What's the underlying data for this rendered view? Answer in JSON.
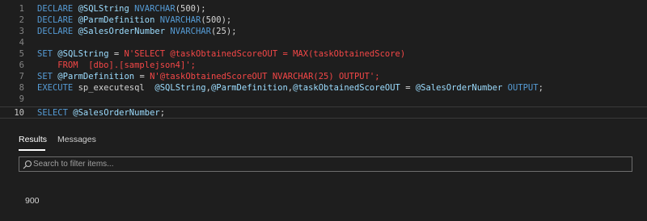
{
  "editor": {
    "lines": [
      {
        "n": "1",
        "tokens": [
          [
            "kw",
            "DECLARE "
          ],
          [
            "var",
            "@SQLString "
          ],
          [
            "kw",
            "NVARCHAR"
          ],
          [
            "plain",
            "(500);"
          ]
        ]
      },
      {
        "n": "2",
        "tokens": [
          [
            "kw",
            "DECLARE "
          ],
          [
            "var",
            "@ParmDefinition "
          ],
          [
            "kw",
            "NVARCHAR"
          ],
          [
            "plain",
            "(500);"
          ]
        ]
      },
      {
        "n": "3",
        "tokens": [
          [
            "kw",
            "DECLARE "
          ],
          [
            "var",
            "@SalesOrderNumber "
          ],
          [
            "kw",
            "NVARCHAR"
          ],
          [
            "plain",
            "(25);"
          ]
        ]
      },
      {
        "n": "4",
        "tokens": []
      },
      {
        "n": "5",
        "tokens": [
          [
            "kw",
            "SET "
          ],
          [
            "var",
            "@SQLString "
          ],
          [
            "plain",
            "= "
          ],
          [
            "str",
            "N'SELECT @taskObtainedScoreOUT = MAX(taskObtainedScore)"
          ]
        ]
      },
      {
        "n": "6",
        "tokens": [
          [
            "str",
            "    FROM  [dbo].[samplejson4]';"
          ]
        ]
      },
      {
        "n": "7",
        "tokens": [
          [
            "kw",
            "SET "
          ],
          [
            "var",
            "@ParmDefinition "
          ],
          [
            "plain",
            "= "
          ],
          [
            "str",
            "N'@taskObtainedScoreOUT NVARCHAR(25) OUTPUT';"
          ]
        ]
      },
      {
        "n": "8",
        "tokens": [
          [
            "kw",
            "EXECUTE "
          ],
          [
            "plain",
            "sp_executesql  "
          ],
          [
            "var",
            "@SQLString"
          ],
          [
            "plain",
            ","
          ],
          [
            "var",
            "@ParmDefinition"
          ],
          [
            "plain",
            ","
          ],
          [
            "var",
            "@taskObtainedScoreOUT "
          ],
          [
            "plain",
            "= "
          ],
          [
            "var",
            "@SalesOrderNumber "
          ],
          [
            "kw",
            "OUTPUT"
          ],
          [
            "plain",
            ";"
          ]
        ]
      },
      {
        "n": "9",
        "tokens": []
      },
      {
        "n": "10",
        "tokens": [
          [
            "kw",
            "SELECT "
          ],
          [
            "var",
            "@SalesOrderNumber"
          ],
          [
            "plain",
            ";"
          ]
        ]
      }
    ],
    "current_line": "10"
  },
  "results": {
    "tabs": [
      "Results",
      "Messages"
    ],
    "active_tab": "Results",
    "filter_placeholder": "Search to filter items...",
    "value": "900"
  }
}
